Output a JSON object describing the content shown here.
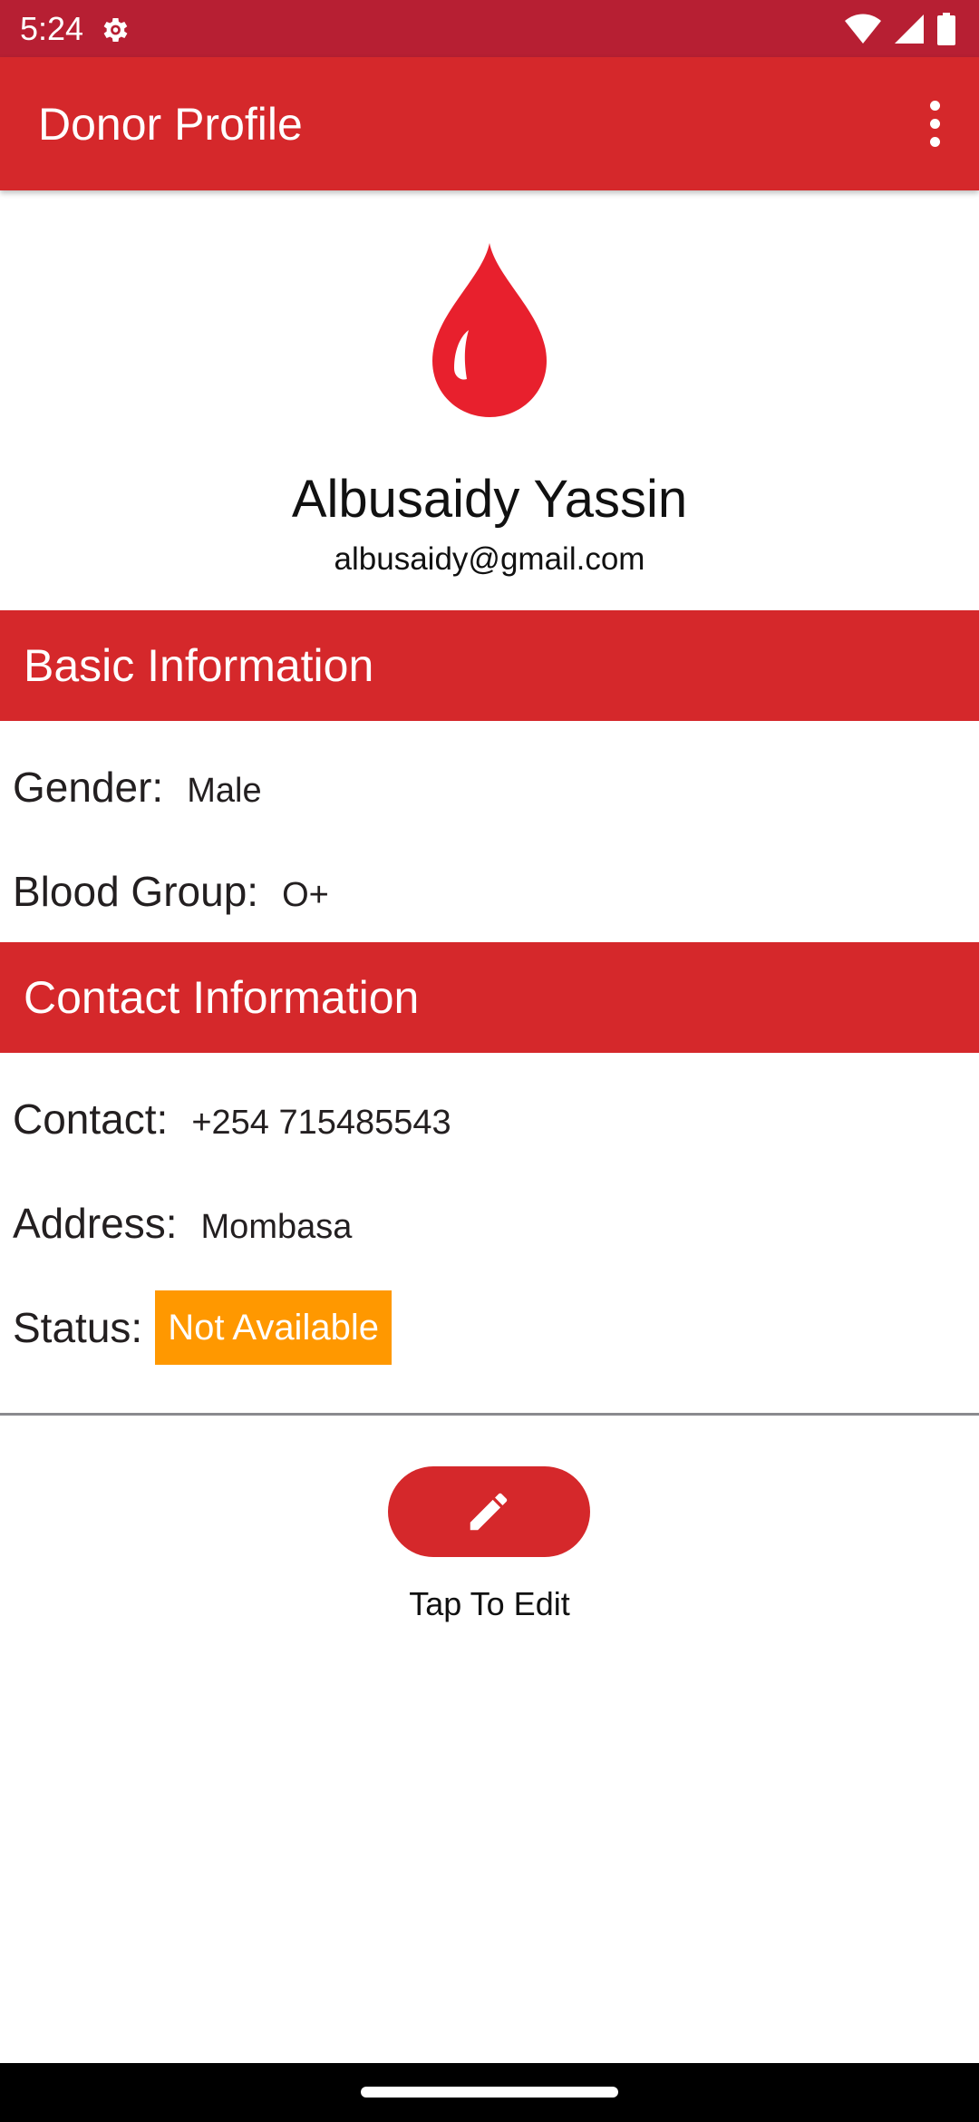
{
  "status_bar": {
    "time": "5:24",
    "icons": [
      "settings-gear-icon",
      "wifi-icon",
      "cellular-signal-icon",
      "battery-icon"
    ]
  },
  "app_bar": {
    "title": "Donor Profile",
    "menu_icon": "more-vert-icon"
  },
  "profile": {
    "icon": "blood-drop-icon",
    "name": "Albusaidy Yassin",
    "email": "albusaidy@gmail.com"
  },
  "basic_info": {
    "title": "Basic Information",
    "gender_label": "Gender:",
    "gender_value": "Male",
    "blood_group_label": "Blood Group:",
    "blood_group_value": "O+"
  },
  "contact_info": {
    "title": "Contact Information",
    "contact_label": "Contact:",
    "contact_value": "+254 715485543",
    "address_label": "Address:",
    "address_value": "Mombasa",
    "status_label": "Status:",
    "status_value": "Not Available"
  },
  "edit": {
    "icon": "pencil-edit-icon",
    "caption": "Tap To Edit"
  },
  "colors": {
    "status_bar": "#b71f33",
    "primary": "#d5282b",
    "blood_drop": "#e8202d",
    "status_badge": "#ff9800",
    "text": "#231f20"
  }
}
